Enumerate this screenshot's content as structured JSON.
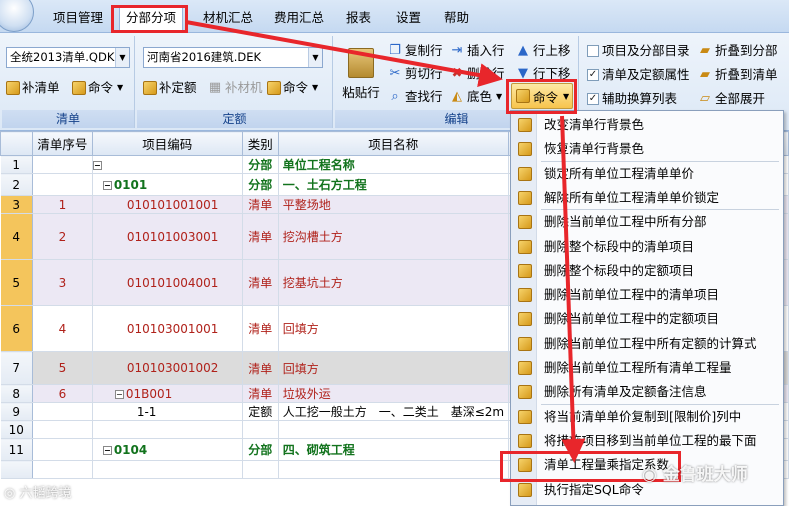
{
  "menu": {
    "items": [
      "项目管理",
      "分部分项",
      "材机汇总",
      "费用汇总",
      "报表",
      "设置",
      "帮助"
    ],
    "active": "分部分项"
  },
  "ribbon": {
    "qingdan": {
      "combo": "全统2013清单.QDK",
      "add_btn": "补清单",
      "cmd_btn": "命令",
      "label": "清单"
    },
    "dinge": {
      "combo": "河南省2016建筑.DEK",
      "add_btn": "补定额",
      "cai_btn": "补材机",
      "cmd_btn": "命令",
      "label": "定额"
    },
    "edit": {
      "paste": "粘贴行",
      "copy": "复制行",
      "cut": "剪切行",
      "find": "查找行",
      "insert": "插入行",
      "delete": "删除行",
      "color": "底色",
      "up": "行上移",
      "down": "行下移",
      "cmd": "命令",
      "label": "编辑"
    },
    "view": {
      "c1": "项目及分部目录",
      "c2": "清单及定额属性",
      "c3": "辅助换算列表",
      "b1": "折叠到分部",
      "b2": "折叠到清单",
      "b3": "全部展开"
    }
  },
  "grid": {
    "headers": [
      "清单序号",
      "项目编码",
      "类别",
      "项目名称"
    ],
    "rows": [
      {
        "n": "1",
        "seq": "",
        "code": "",
        "type": "分部",
        "name": "单位工程名称",
        "style": "bold",
        "tree": "⊟"
      },
      {
        "n": "2",
        "seq": "",
        "code": "0101",
        "type": "分部",
        "name": "一、土石方工程",
        "style": "bold",
        "tree": "⊟"
      },
      {
        "n": "3",
        "seq": "1",
        "code": "010101001001",
        "type": "清单",
        "name": "平整场地",
        "style": "red lav",
        "tree": ""
      },
      {
        "n": "4",
        "seq": "2",
        "code": "010101003001",
        "type": "清单",
        "name": "挖沟槽土方",
        "style": "red lav",
        "tree": ""
      },
      {
        "n": "5",
        "seq": "3",
        "code": "010101004001",
        "type": "清单",
        "name": "挖基坑土方",
        "style": "red lav",
        "tree": ""
      },
      {
        "n": "6",
        "seq": "4",
        "code": "010103001001",
        "type": "清单",
        "name": "回填方",
        "style": "red",
        "tree": ""
      },
      {
        "n": "7",
        "seq": "5",
        "code": "010103001002",
        "type": "清单",
        "name": "回填方",
        "style": "red gry",
        "tree": ""
      },
      {
        "n": "8",
        "seq": "6",
        "code": "01B001",
        "type": "清单",
        "name": "垃圾外运",
        "style": "red lav",
        "tree": "⊟"
      },
      {
        "n": "9",
        "seq": "",
        "code": "1-1",
        "type": "定额",
        "name": "人工挖一般土方　一、二类土　基深≤2m",
        "style": "",
        "tree": ""
      },
      {
        "n": "10",
        "seq": "",
        "code": "",
        "type": "",
        "name": "",
        "style": "",
        "tree": ""
      },
      {
        "n": "11",
        "seq": "",
        "code": "0104",
        "type": "分部",
        "name": "四、砌筑工程",
        "style": "bold",
        "tree": "⊟"
      },
      {
        "n": "",
        "seq": "",
        "code": "",
        "type": "",
        "name": "",
        "style": "",
        "tree": ""
      }
    ]
  },
  "dropdown": {
    "items": [
      "改变清单行背景色",
      "恢复清单行背景色",
      "锁定所有单位工程清单单价",
      "解除所有单位工程清单单价锁定",
      "删除当前单位工程中所有分部",
      "删除整个标段中的清单项目",
      "删除整个标段中的定额项目",
      "删除当前单位工程中的清单项目",
      "删除当前单位工程中的定额项目",
      "删除当前单位工程中所有定额的计算式",
      "删除当前单位工程所有清单工程量",
      "删除所有清单及定额备注信息",
      "将当前清单单价复制到[限制价]列中",
      "将措施项目移到当前单位工程的最下面",
      "清单工程量乘指定系数",
      "执行指定SQL命令"
    ]
  },
  "watermarks": {
    "left": "六韬跨境",
    "right": "金鲁班大师"
  },
  "colors": {
    "highlight": "#e8262b",
    "selected_row_num": "#f4c55c",
    "green_text": "#12731d",
    "red_text": "#b0211a"
  }
}
